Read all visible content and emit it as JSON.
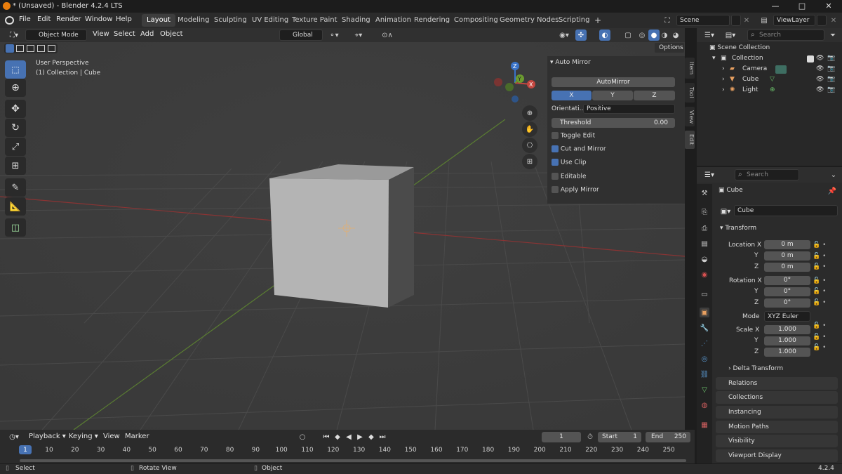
{
  "window": {
    "title": "* (Unsaved) - Blender 4.2.4 LTS",
    "minimize": "—",
    "maximize": "□",
    "close": "✕"
  },
  "menus": [
    "File",
    "Edit",
    "Render",
    "Window",
    "Help"
  ],
  "workspaces": [
    "Layout",
    "Modeling",
    "Sculpting",
    "UV Editing",
    "Texture Paint",
    "Shading",
    "Animation",
    "Rendering",
    "Compositing",
    "Geometry Nodes",
    "Scripting"
  ],
  "active_workspace": "Layout",
  "add_workspace": "+",
  "scene": {
    "name": "Scene",
    "view_layer": "ViewLayer"
  },
  "viewport": {
    "mode": "Object Mode",
    "menus": [
      "View",
      "Select",
      "Add",
      "Object"
    ],
    "orientation": "Global",
    "options_label": "Options",
    "info_line1": "User Perspective",
    "info_line2": "(1) Collection | Cube",
    "gizmo": {
      "x": "X",
      "y": "Y",
      "z": "Z"
    }
  },
  "npanel": {
    "header": "Auto Mirror",
    "button": "AutoMirror",
    "axes": [
      "X",
      "Y",
      "Z"
    ],
    "orientation_label": "Orientati...",
    "orientation_value": "Positive",
    "threshold_label": "Threshold",
    "threshold_value": "0.00",
    "options": [
      {
        "label": "Toggle Edit",
        "checked": false
      },
      {
        "label": "Cut and Mirror",
        "checked": true
      },
      {
        "label": "Use Clip",
        "checked": true
      },
      {
        "label": "Editable",
        "checked": false
      },
      {
        "label": "Apply Mirror",
        "checked": false
      }
    ],
    "tabs": [
      "Item",
      "Tool",
      "View",
      "Edit"
    ]
  },
  "outliner": {
    "search_placeholder": "Search",
    "root": "Scene Collection",
    "collection": "Collection",
    "items": [
      "Camera",
      "Cube",
      "Light"
    ]
  },
  "properties": {
    "search_placeholder": "Search",
    "object_name": "Cube",
    "data_name": "Cube",
    "transform_header": "Transform",
    "location_label": "Location X",
    "location": [
      "0 m",
      "0 m",
      "0 m"
    ],
    "rotation_label": "Rotation X",
    "rotation": [
      "0°",
      "0°",
      "0°"
    ],
    "mode_label": "Mode",
    "mode_value": "XYZ Euler",
    "scale_label": "Scale X",
    "scale": [
      "1.000",
      "1.000",
      "1.000"
    ],
    "axis_y": "Y",
    "axis_z": "Z",
    "subpanels": [
      "Delta Transform",
      "Relations",
      "Collections",
      "Instancing",
      "Motion Paths",
      "Visibility",
      "Viewport Display"
    ]
  },
  "timeline": {
    "menus": [
      "Playback",
      "Keying",
      "View",
      "Marker"
    ],
    "current_frame": "1",
    "start_label": "Start",
    "start": "1",
    "end_label": "End",
    "end": "250",
    "ticks": [
      "1",
      "10",
      "20",
      "30",
      "40",
      "50",
      "60",
      "70",
      "80",
      "90",
      "100",
      "110",
      "120",
      "130",
      "140",
      "150",
      "160",
      "170",
      "180",
      "190",
      "200",
      "210",
      "220",
      "230",
      "240",
      "250"
    ]
  },
  "statusbar": {
    "select": "Select",
    "rotate": "Rotate View",
    "object": "Object",
    "version": "4.2.4"
  },
  "colors": {
    "accent": "#4772b3",
    "x_axis": "#c4463f",
    "y_axis": "#6b9b30",
    "z_axis": "#3a73c8"
  }
}
